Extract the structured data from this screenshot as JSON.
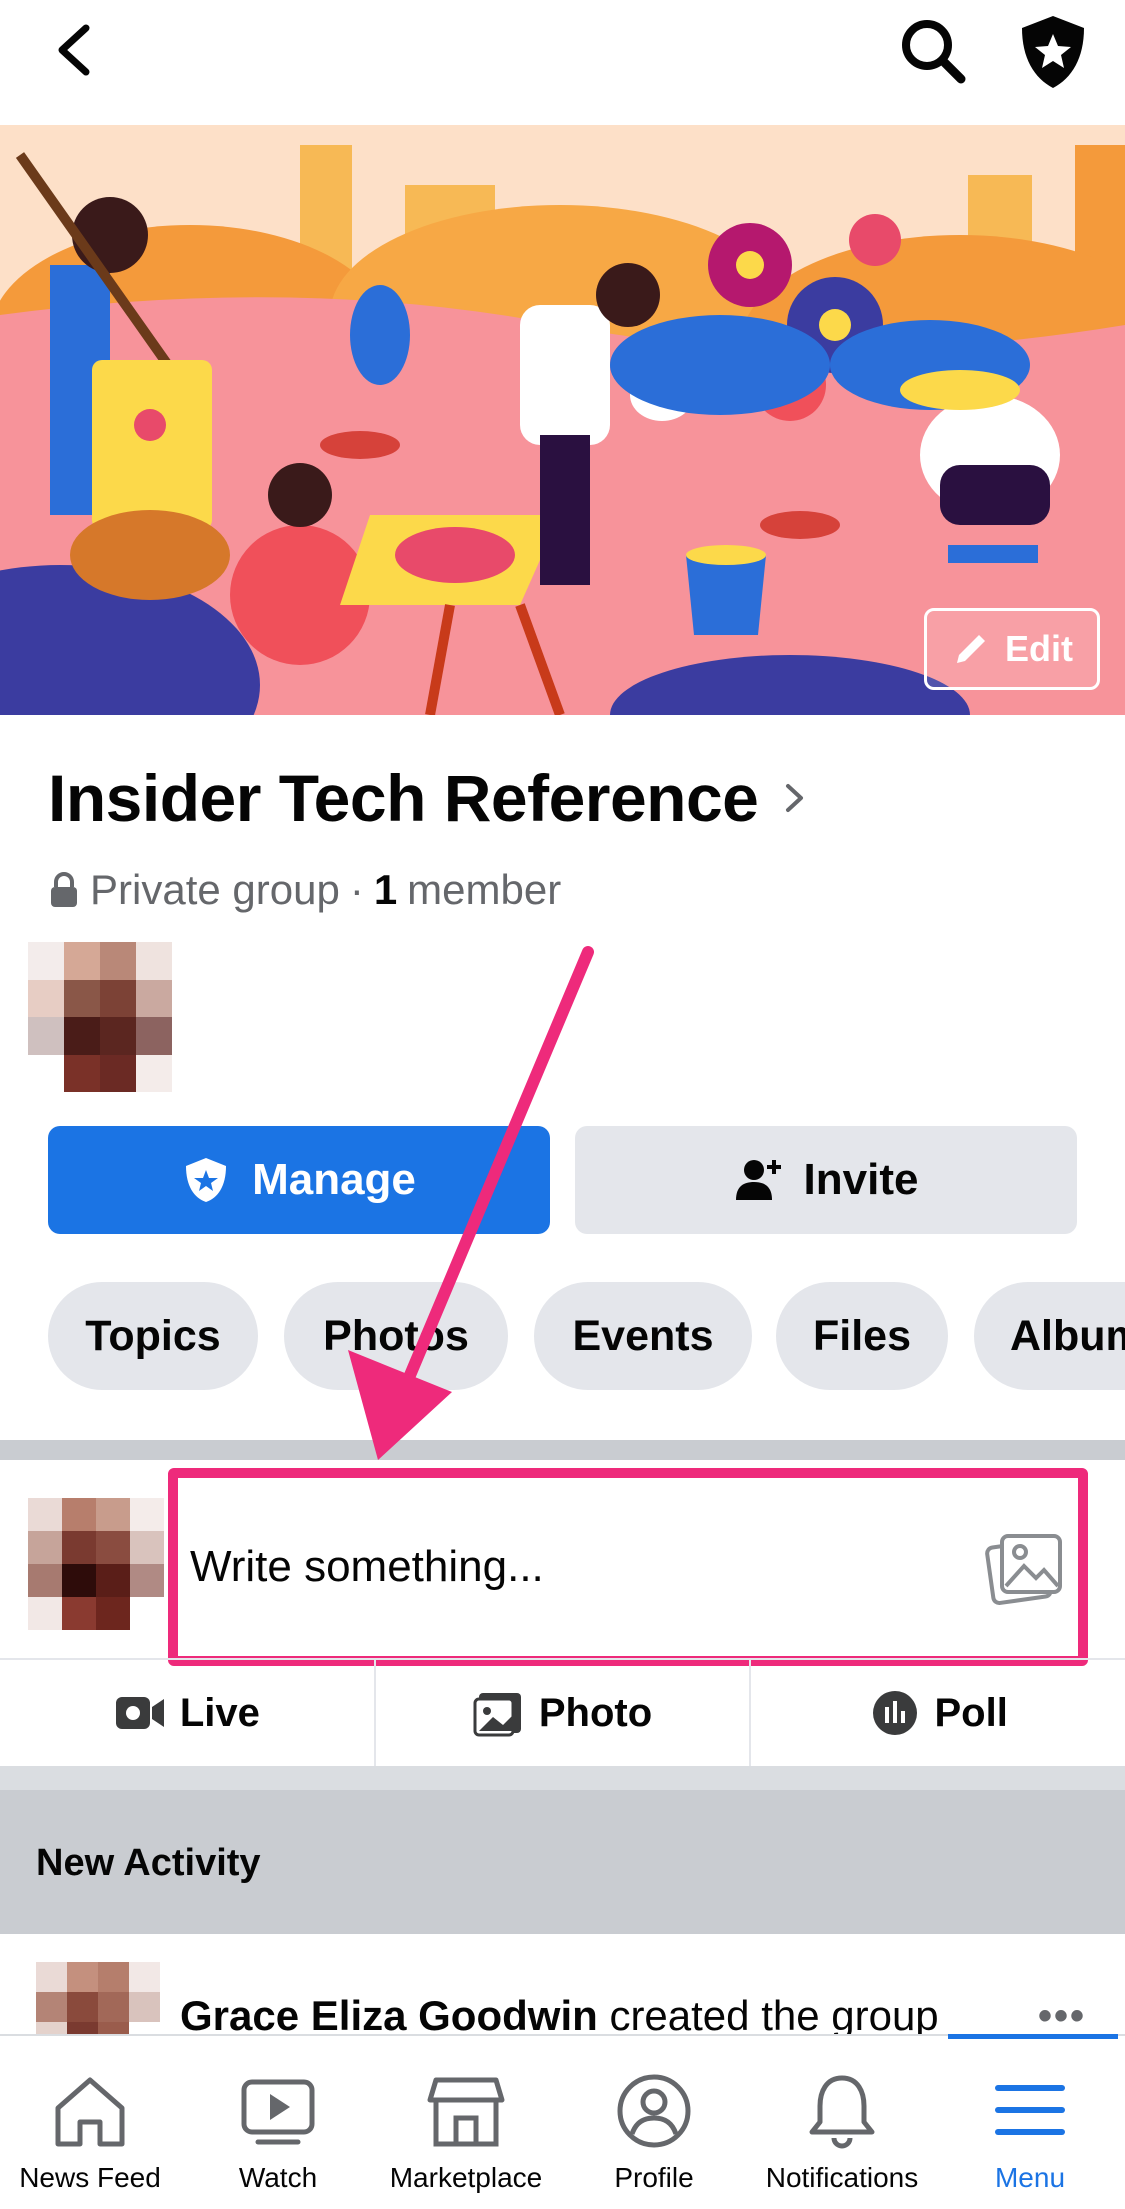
{
  "top_bar": {
    "icons": [
      "back-chevron-icon",
      "search-icon",
      "admin-shield-icon"
    ]
  },
  "cover": {
    "edit_label": "Edit"
  },
  "group": {
    "name": "Insider Tech Reference",
    "privacy": "Private group",
    "separator": "·",
    "member_count": "1",
    "member_word": "member"
  },
  "buttons": {
    "manage": "Manage",
    "invite": "Invite"
  },
  "chips": [
    {
      "label": "Topics"
    },
    {
      "label": "Photos"
    },
    {
      "label": "Events"
    },
    {
      "label": "Files"
    },
    {
      "label": "Albums"
    }
  ],
  "composer": {
    "placeholder": "Write something..."
  },
  "actions": [
    {
      "label": "Live",
      "icon": "video-camera-icon"
    },
    {
      "label": "Photo",
      "icon": "photo-icon"
    },
    {
      "label": "Poll",
      "icon": "poll-icon"
    }
  ],
  "activity": {
    "header": "New Activity",
    "item": {
      "actor": "Grace Eliza Goodwin",
      "action": "created the group"
    }
  },
  "tabs": [
    {
      "label": "News Feed",
      "icon": "home-icon"
    },
    {
      "label": "Watch",
      "icon": "watch-play-icon"
    },
    {
      "label": "Marketplace",
      "icon": "storefront-icon"
    },
    {
      "label": "Profile",
      "icon": "profile-icon"
    },
    {
      "label": "Notifications",
      "icon": "bell-icon"
    },
    {
      "label": "Menu",
      "icon": "hamburger-menu-icon",
      "active": true
    }
  ],
  "colors": {
    "brand_blue": "#1b74e4",
    "highlight_pink": "#ee2a7b",
    "secondary_button": "#e4e6eb",
    "muted_text": "#65676b"
  }
}
